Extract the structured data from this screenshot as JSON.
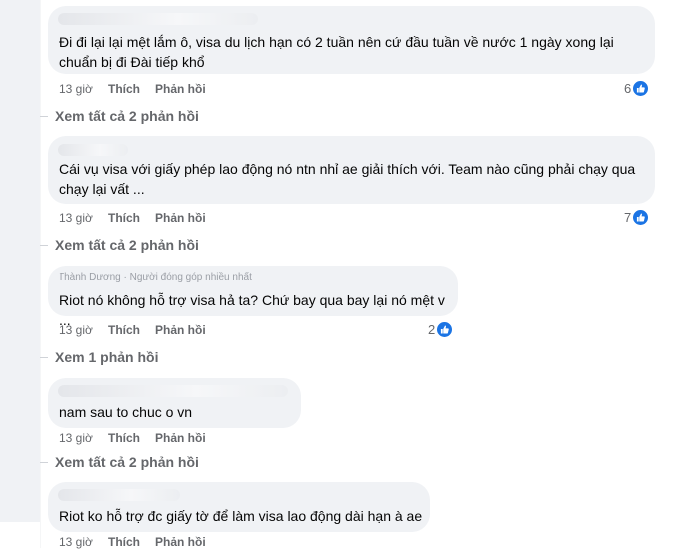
{
  "comments": [
    {
      "author": "",
      "text_lines": [
        "Đi đi lại lại mệt lắm ô, visa du lịch hạn có 2 tuần nên cứ đầu tuần về nước 1 ngày xong lại",
        "chuẩn bị đi Đài tiếp khổ"
      ],
      "time": "13 giờ",
      "like_label": "Thích",
      "reply_label": "Phản hồi",
      "reaction_count": "6",
      "view_replies": "Xem tất cả 2 phản hồi"
    },
    {
      "author": "",
      "text_lines": [
        "Cái vụ visa với giấy phép lao động nó ntn nhỉ ae giải thích với. Team nào cũng phải chạy qua",
        "chạy lại vất ..."
      ],
      "time": "13 giờ",
      "like_label": "Thích",
      "reply_label": "Phản hồi",
      "reaction_count": "7",
      "view_replies": "Xem tất cả 2 phản hồi"
    },
    {
      "author": "Thành Dương · Người đóng góp nhiều nhất",
      "text_lines": [
        "Riot nó không hỗ trợ visa hả ta? Chứ bay qua bay lại nó mệt v ..."
      ],
      "time": "13 giờ",
      "like_label": "Thích",
      "reply_label": "Phản hồi",
      "reaction_count": "2",
      "view_replies": "Xem 1 phản hồi"
    },
    {
      "author": "",
      "text_lines": [
        "nam sau to chuc o vn"
      ],
      "time": "13 giờ",
      "like_label": "Thích",
      "reply_label": "Phản hồi",
      "view_replies": "Xem tất cả 2 phản hồi"
    },
    {
      "author": "",
      "text_lines": [
        "Riot ko hỗ trợ đc giấy tờ để làm visa lao động dài hạn à ae"
      ],
      "time": "13 giờ",
      "like_label": "Thích",
      "reply_label": "Phản hồi"
    }
  ],
  "colors": {
    "bubble": "#f0f2f5",
    "like_blue": "#1b74e4",
    "meta": "#65676b"
  },
  "icons": {
    "reaction": "like-thumb-icon"
  }
}
